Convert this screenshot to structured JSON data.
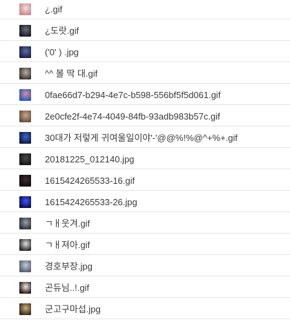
{
  "files": [
    {
      "name": "¿.gif",
      "thumb_colors": [
        "#f3dede",
        "#c98b8b"
      ]
    },
    {
      "name": "¿도랏.gif",
      "thumb_colors": [
        "#6b6b7a",
        "#1c1c26"
      ]
    },
    {
      "name": "('0' ) .jpg",
      "thumb_colors": [
        "#5a6ea8",
        "#1f2442"
      ]
    },
    {
      "name": "^^ 볼 딱 대.gif",
      "thumb_colors": [
        "#b7b0a8",
        "#3d3833"
      ]
    },
    {
      "name": "0fae66d7-b294-4e7c-b598-556bf5f5d061.gif",
      "thumb_colors": [
        "#d98ea6",
        "#2a5bb0"
      ]
    },
    {
      "name": "2e0cfe2f-4e74-4049-84fb-93adb983b57c.gif",
      "thumb_colors": [
        "#c6a88e",
        "#6b4f3c"
      ]
    },
    {
      "name": "30대가 저렇게 귀여울일이야'-'@@%!%@^+%+.gif",
      "thumb_colors": [
        "#3a66d8",
        "#111a3a"
      ]
    },
    {
      "name": "20181225_012140.jpg",
      "thumb_colors": [
        "#4a4a4a",
        "#161616"
      ]
    },
    {
      "name": "1615424265533-16.gif",
      "thumb_colors": [
        "#3b2e33",
        "#0d0a0b"
      ]
    },
    {
      "name": "1615424265533-26.jpg",
      "thumb_colors": [
        "#3f54ff",
        "#0a0f4a"
      ]
    },
    {
      "name": "ㄱㅐ웃겨.gif",
      "thumb_colors": [
        "#9aa0a8",
        "#2e3136"
      ]
    },
    {
      "name": "ㄱㅐ져아.gif",
      "thumb_colors": [
        "#e0e0e0",
        "#2a2a2a"
      ]
    },
    {
      "name": "경호부장.jpg",
      "thumb_colors": [
        "#c4ccd4",
        "#556070"
      ]
    },
    {
      "name": "곤듀님..!.gif",
      "thumb_colors": [
        "#f0e8e6",
        "#2b1a16"
      ]
    },
    {
      "name": "군고구마섭.jpg",
      "thumb_colors": [
        "#c9b07a",
        "#3a2e1c"
      ]
    }
  ]
}
